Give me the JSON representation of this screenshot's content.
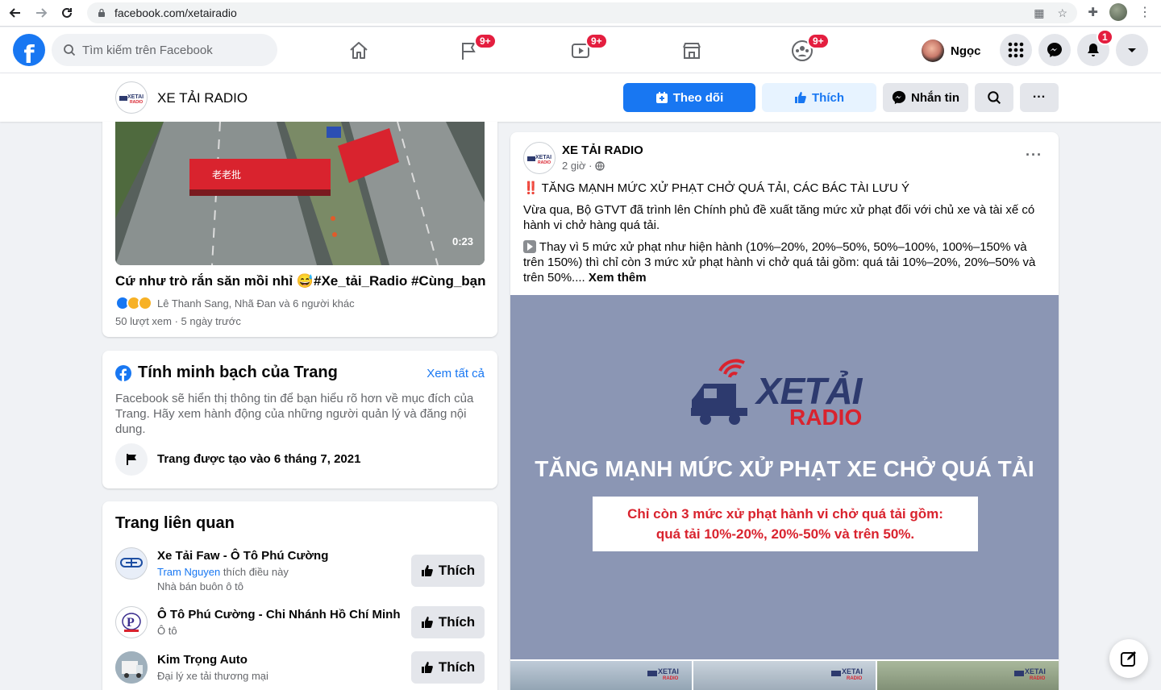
{
  "browser": {
    "url": "facebook.com/xetairadio"
  },
  "fb_header": {
    "search_placeholder": "Tìm kiếm trên Facebook",
    "nav_badges": {
      "pages": "9+",
      "watch": "9+",
      "groups": "9+"
    },
    "profile_name": "Ngọc",
    "notifications_badge": "1"
  },
  "page_header": {
    "name": "XE TẢI RADIO",
    "follow_label": "Theo dõi",
    "like_label": "Thích",
    "message_label": "Nhắn tin"
  },
  "video_card": {
    "duration": "0:23",
    "caption": "Cứ như trò rắn săn mồi nhỉ 😅#Xe_tải_Radio #Cùng_bạn...",
    "reactions": "Lê Thanh Sang, Nhã Đan và 6 người khác",
    "meta": "50 lượt xem · 5 ngày trước"
  },
  "transparency": {
    "title": "Tính minh bạch của Trang",
    "see_all": "Xem tất cả",
    "description": "Facebook sẽ hiển thị thông tin để bạn hiểu rõ hơn về mục đích của Trang. Hãy xem hành động của những người quản lý và đăng nội dung.",
    "created": "Trang được tạo vào 6 tháng 7, 2021"
  },
  "related": {
    "title": "Trang liên quan",
    "items": [
      {
        "name": "Xe Tải Faw - Ô Tô Phú Cường",
        "liker": "Tram Nguyen",
        "liker_suffix": "thích điều này",
        "category": "Nhà bán buôn ô tô",
        "button": "Thích"
      },
      {
        "name": "Ô Tô Phú Cường - Chi Nhánh Hồ Chí Minh",
        "category": "Ô tô",
        "button": "Thích"
      },
      {
        "name": "Kim Trọng Auto",
        "category": "Đại lý xe tải thương mại",
        "button": "Thích"
      }
    ]
  },
  "post": {
    "author": "XE TẢI RADIO",
    "time": "2 giờ ·",
    "headline_icon": "‼️",
    "headline": "TĂNG MẠNH MỨC XỬ PHẠT CHỞ QUÁ TẢI, CÁC BÁC TÀI LƯU Ý",
    "para1": "Vừa qua, Bộ GTVT đã trình lên Chính phủ đề xuất tăng mức xử phạt đối với chủ xe và tài xế có hành vi chở hàng quá tải.",
    "para2": "Thay vì 5 mức xử phạt như hiện hành (10%–20%, 20%–50%, 50%–100%, 100%–150% và trên 150%) thì chỉ còn 3 mức xử phạt hành vi chở quá tải gồm: quá tải 10%–20%, 20%–50% và trên 50%....",
    "see_more": "Xem thêm",
    "image": {
      "logo_line1": "XETẢI",
      "logo_line2": "RADIO",
      "headline": "TĂNG MẠNH MỨC XỬ PHẠT XE CHỞ QUÁ TẢI",
      "box_line1": "Chỉ còn 3 mức xử phạt hành vi chở quá tải gồm:",
      "box_line2": "quá tải 10%-20%, 20%-50% và trên 50%."
    },
    "thumb_logo": "XETẢI"
  },
  "colors": {
    "fb_blue": "#1877f2",
    "brand_red": "#d9232e",
    "brand_navy": "#2d3a6e",
    "image_bg": "#8b96b4"
  }
}
